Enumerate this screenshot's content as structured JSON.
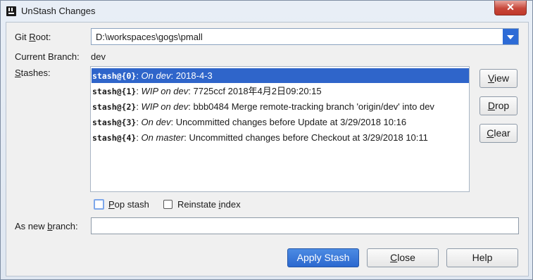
{
  "window": {
    "title": "UnStash Changes",
    "close_glyph": "✕"
  },
  "git_root": {
    "label_pre": "Git ",
    "label_mn": "R",
    "label_post": "oot:",
    "value": "D:\\workspaces\\gogs\\pmall"
  },
  "current_branch": {
    "label": "Current Branch:",
    "value": "dev"
  },
  "stashes": {
    "label_mn": "S",
    "label_rest": "tashes:",
    "items": [
      {
        "ref": "stash@{0}",
        "sep": ": ",
        "branch": "On dev",
        "message": ": 2018-4-3"
      },
      {
        "ref": "stash@{1}",
        "sep": ": ",
        "branch": "WIP on dev",
        "message": ": 7725ccf 2018年4月2日09:20:15"
      },
      {
        "ref": "stash@{2}",
        "sep": ": ",
        "branch": "WIP on dev",
        "message": ": bbb0484 Merge remote-tracking branch 'origin/dev' into dev"
      },
      {
        "ref": "stash@{3}",
        "sep": ": ",
        "branch": "On dev",
        "message": ": Uncommitted changes before Update at 3/29/2018 10:16"
      },
      {
        "ref": "stash@{4}",
        "sep": ": ",
        "branch": "On master",
        "message": ": Uncommitted changes before Checkout at 3/29/2018 10:11"
      }
    ],
    "selected_index": 0
  },
  "side_buttons": {
    "view": {
      "mn": "V",
      "rest": "iew"
    },
    "drop": {
      "mn": "D",
      "rest": "rop"
    },
    "clear": {
      "mn": "C",
      "rest": "lear"
    }
  },
  "options": {
    "pop_stash": {
      "mn": "P",
      "rest": "op stash",
      "checked": false
    },
    "reinstate_index": {
      "pre": "Reinstate ",
      "mn": "i",
      "rest": "ndex",
      "checked": false
    }
  },
  "new_branch": {
    "pre": "As new ",
    "mn": "b",
    "rest": "ranch:",
    "value": ""
  },
  "footer": {
    "apply": "Apply Stash",
    "close": {
      "mn": "C",
      "rest": "lose"
    },
    "help": "Help"
  }
}
